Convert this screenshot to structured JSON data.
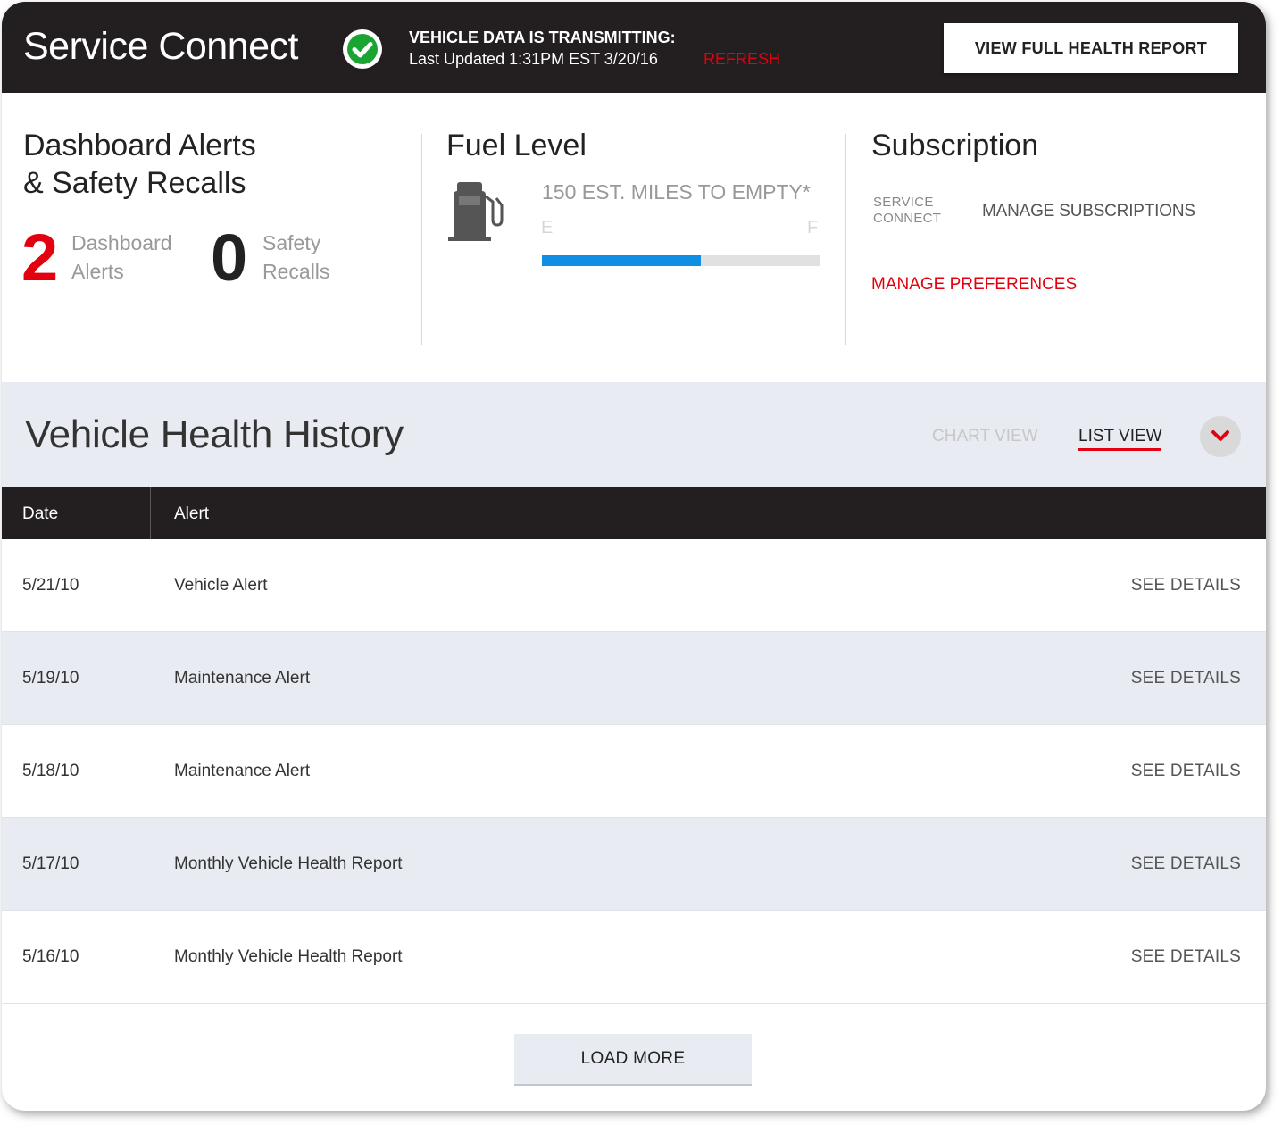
{
  "header": {
    "app_title": "Service Connect",
    "status_title": "VEHICLE DATA IS TRANSMITTING:",
    "last_updated": "Last Updated 1:31PM EST 3/20/16",
    "refresh_label": "REFRESH",
    "health_report_label": "VIEW FULL HEALTH REPORT",
    "status_icon": "check-circle-icon"
  },
  "alerts": {
    "title_line1": "Dashboard Alerts",
    "title_line2": "& Safety Recalls",
    "dashboard_count": "2",
    "dashboard_label_line1": "Dashboard",
    "dashboard_label_line2": "Alerts",
    "recall_count": "0",
    "recall_label_line1": "Safety",
    "recall_label_line2": "Recalls"
  },
  "fuel": {
    "title": "Fuel Level",
    "miles_text": "150 EST. MILES TO EMPTY*",
    "empty_label": "E",
    "full_label": "F",
    "level_percent": 57,
    "icon": "fuel-pump-icon"
  },
  "subscription": {
    "title": "Subscription",
    "name_line1": "SERVICE",
    "name_line2": "CONNECT",
    "manage_subscriptions_label": "MANAGE SUBSCRIPTIONS",
    "manage_preferences_label": "MANAGE PREFERENCES"
  },
  "history": {
    "title": "Vehicle Health History",
    "chart_view_label": "CHART VIEW",
    "list_view_label": "LIST VIEW",
    "columns": [
      "Date",
      "Alert"
    ],
    "rows": [
      {
        "date": "5/21/10",
        "alert": "Vehicle Alert",
        "action": "SEE DETAILS"
      },
      {
        "date": "5/19/10",
        "alert": "Maintenance Alert",
        "action": "SEE DETAILS"
      },
      {
        "date": "5/18/10",
        "alert": "Maintenance Alert",
        "action": "SEE DETAILS"
      },
      {
        "date": "5/17/10",
        "alert": "Monthly Vehicle Health Report",
        "action": "SEE DETAILS"
      },
      {
        "date": "5/16/10",
        "alert": "Monthly Vehicle Health Report",
        "action": "SEE DETAILS"
      }
    ],
    "load_more_label": "LOAD MORE"
  },
  "colors": {
    "header_bg": "#231f20",
    "accent_red": "#e3000f",
    "fuel_blue": "#0f8fe4",
    "check_green": "#1aa532",
    "alt_row_bg": "#e8ecf2"
  }
}
